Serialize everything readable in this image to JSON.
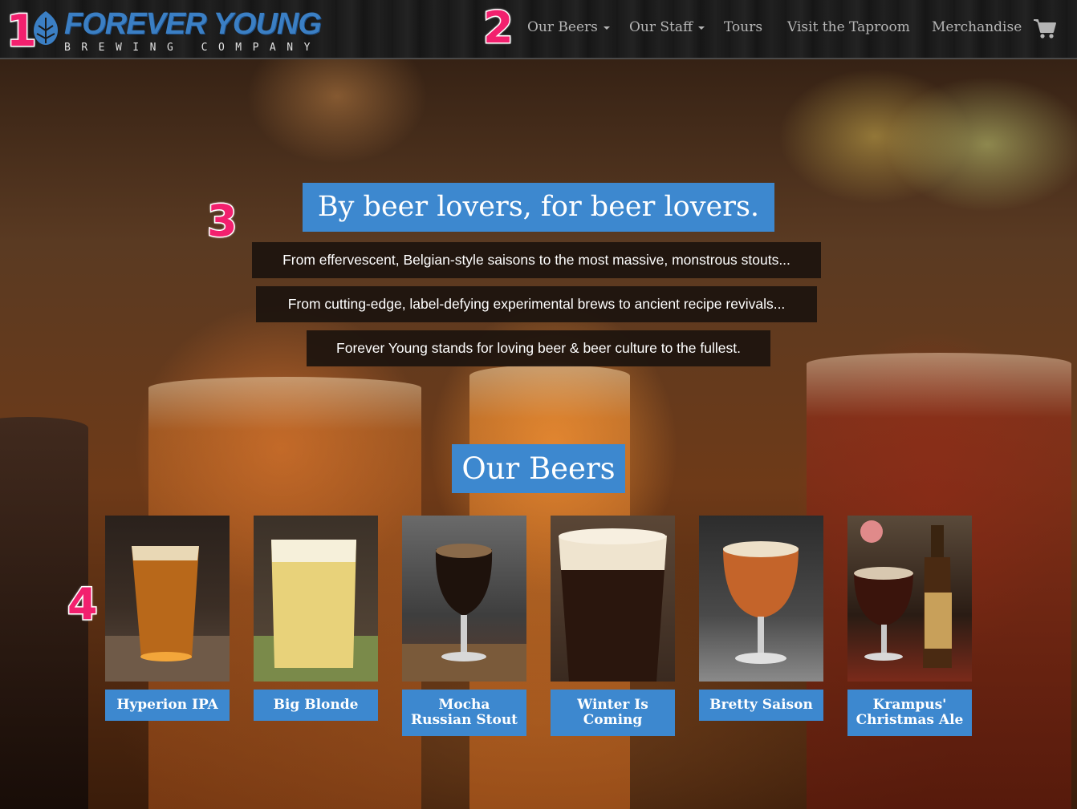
{
  "brand": {
    "title": "FOREVER YOUNG",
    "subtitle": "BREWING COMPANY",
    "logo_icon": "hop-icon",
    "accent_color": "#3b7fc4"
  },
  "nav": {
    "items": [
      {
        "label": "Our Beers",
        "dropdown": true
      },
      {
        "label": "Our Staff",
        "dropdown": true
      },
      {
        "label": "Tours",
        "dropdown": false
      },
      {
        "label": "Visit the Taproom",
        "dropdown": false
      },
      {
        "label": "Merchandise",
        "dropdown": false
      }
    ],
    "cart_icon": "shopping-cart-icon"
  },
  "hero": {
    "title": "By beer lovers, for beer lovers.",
    "taglines": [
      "From effervescent, Belgian-style saisons to the most massive, monstrous stouts...",
      "From cutting-edge, label-defying experimental brews to ancient recipe revivals...",
      "Forever Young stands for loving beer & beer culture to the fullest."
    ]
  },
  "beers_section": {
    "title": "Our Beers",
    "beers": [
      {
        "name": "Hyperion IPA",
        "beer_color": "#b8681a"
      },
      {
        "name": "Big Blonde",
        "beer_color": "#e8d27a"
      },
      {
        "name": "Mocha Russian Stout",
        "beer_color": "#1e120c"
      },
      {
        "name": "Winter Is Coming",
        "beer_color": "#2a160d"
      },
      {
        "name": "Bretty Saison",
        "beer_color": "#c4642a"
      },
      {
        "name": "Krampus' Christmas Ale",
        "beer_color": "#3a140c"
      }
    ]
  },
  "callouts": [
    "1",
    "2",
    "3",
    "4"
  ],
  "colors": {
    "accent_blue": "#3d88cf",
    "tag_bg": "#1c140e",
    "callout_pink": "#f2206e",
    "nav_text": "#b5b5b5"
  }
}
